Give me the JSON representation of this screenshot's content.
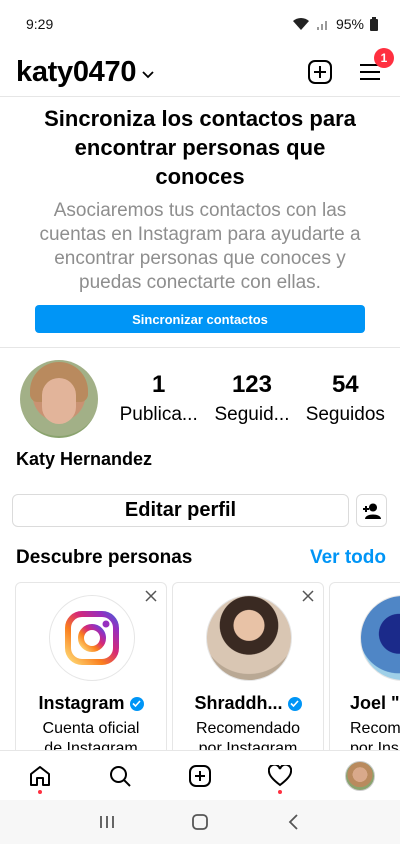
{
  "status_bar": {
    "time": "9:29",
    "battery": "95%"
  },
  "header": {
    "username": "katy0470",
    "notification_count": "1"
  },
  "sync_card": {
    "title": "Sincroniza los contactos para encontrar personas que conoces",
    "body": "Asociaremos tus contactos con las cuentas en Instagram para ayudarte a encontrar personas que conoces y puedas conectarte con ellas.",
    "button_label": "Sincronizar contactos"
  },
  "profile": {
    "full_name": "Katy Hernandez",
    "stats": [
      {
        "value": "1",
        "label": "Publica..."
      },
      {
        "value": "123",
        "label": "Seguid..."
      },
      {
        "value": "54",
        "label": "Seguidos"
      }
    ],
    "edit_label": "Editar perfil"
  },
  "discover": {
    "title": "Descubre personas",
    "see_all": "Ver todo",
    "cards": [
      {
        "name": "Instagram",
        "subtitle_1": "Cuenta oficial",
        "subtitle_2": "de Instagram",
        "verified": true
      },
      {
        "name": "Shraddh...",
        "subtitle_1": "Recomendado",
        "subtitle_2": "por Instagram",
        "verified": true
      },
      {
        "name": "Joel \"",
        "subtitle_1": "Recom",
        "subtitle_2": "por Ins",
        "verified": false
      }
    ]
  },
  "colors": {
    "accent": "#0095f6",
    "badge": "#ff3040",
    "muted": "#8e8e8e"
  }
}
